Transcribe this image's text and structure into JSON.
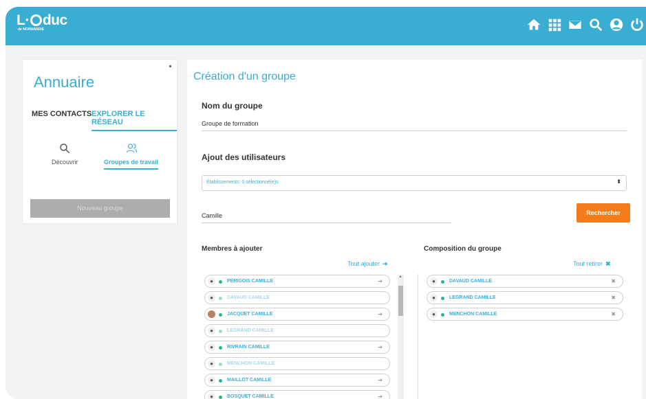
{
  "header": {
    "logo_prefix": "L·",
    "logo_suffix": "duc",
    "logo_sub": "de NORMANDIE",
    "icons": [
      "home-icon",
      "apps-grid-icon",
      "mail-icon",
      "search-icon",
      "user-icon",
      "power-icon"
    ],
    "bar_color": "#3aaed2"
  },
  "sidebar": {
    "title": "Annuaire",
    "tabs": [
      {
        "label": "MES CONTACTS",
        "active": false
      },
      {
        "label": "EXPLORER LE RÉSEAU",
        "active": true
      }
    ],
    "tools": [
      {
        "label": "Découvrir",
        "icon": "search-icon",
        "active": false
      },
      {
        "label": "Groupes de travail",
        "icon": "users-icon",
        "active": true
      }
    ],
    "new_group_button": "Nouveau groupe"
  },
  "main": {
    "title": "Création d'un groupe",
    "group_name_label": "Nom du groupe",
    "group_name_value": "Groupe de formation",
    "add_users_label": "Ajout des utilisateurs",
    "establishment_select": "Établissements: 0 sélectionné(e)s",
    "search_value": "Camille",
    "search_button": "Rechercher",
    "accent_color": "#f47c1b"
  },
  "members_to_add": {
    "title": "Membres à ajouter",
    "action": "Tout ajouter",
    "items": [
      {
        "name": "PERIGOIS CAMILLE",
        "faded": false,
        "photo": false
      },
      {
        "name": "DAVAUD CAMILLE",
        "faded": true,
        "photo": false
      },
      {
        "name": "JACQUET CAMILLE",
        "faded": false,
        "photo": true
      },
      {
        "name": "LEGRAND CAMILLE",
        "faded": true,
        "photo": false
      },
      {
        "name": "RIVRAIN CAMILLE",
        "faded": false,
        "photo": false
      },
      {
        "name": "MENCHON CAMILLE",
        "faded": true,
        "photo": false
      },
      {
        "name": "MAILLOT CAMILLE",
        "faded": false,
        "photo": false
      },
      {
        "name": "BOSQUET CAMILLE",
        "faded": false,
        "photo": false
      }
    ]
  },
  "composition": {
    "title": "Composition du groupe",
    "action": "Tout retirer",
    "items": [
      {
        "name": "DAVAUD CAMILLE"
      },
      {
        "name": "LEGRAND CAMILLE"
      },
      {
        "name": "MENCHON CAMILLE"
      }
    ]
  }
}
